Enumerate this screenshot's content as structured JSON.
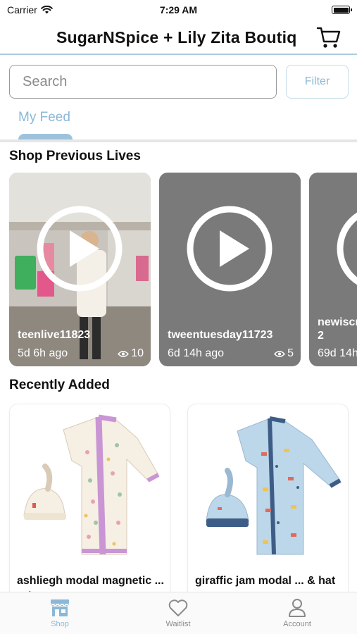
{
  "status_bar": {
    "carrier": "Carrier",
    "time": "7:29 AM"
  },
  "header": {
    "title": "SugarNSpice + Lily Zita Boutiq"
  },
  "search": {
    "placeholder": "Search",
    "filter_label": "Filter"
  },
  "tabs": {
    "my_feed": "My Feed"
  },
  "previous_lives": {
    "title": "Shop Previous Lives",
    "items": [
      {
        "name": "teenlive11823",
        "age": "5d 6h ago",
        "views": "10"
      },
      {
        "name": "tweentuesday11723",
        "age": "6d 14h ago",
        "views": "5"
      },
      {
        "name_line1": "newiscr",
        "name_line2": "2",
        "age": "69d 14h"
      }
    ]
  },
  "recently_added": {
    "title": "Recently Added",
    "items": [
      {
        "name": "ashliegh modal magnetic ... & hat"
      },
      {
        "name": "giraffic jam modal ... & hat"
      }
    ]
  },
  "tab_bar": {
    "shop": "Shop",
    "waitlist": "Waitlist",
    "account": "Account"
  },
  "colors": {
    "accent": "#8ab8d6",
    "accent_border": "#a9cbe0",
    "card_gray": "#7a7a7a",
    "tab_inactive": "#8a8a8a"
  },
  "icons": {
    "cart": "cart-icon",
    "play": "play-icon",
    "eye": "eye-icon",
    "shop": "storefront-icon",
    "waitlist": "heart-icon",
    "account": "person-icon"
  }
}
